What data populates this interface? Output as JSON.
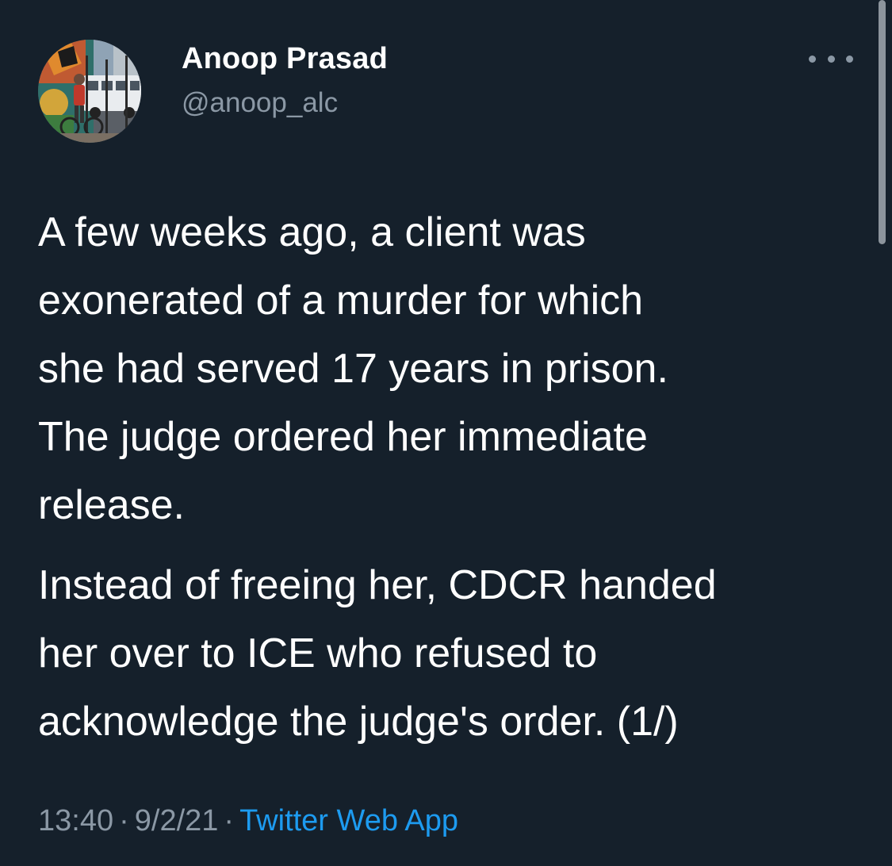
{
  "author": {
    "display_name": "Anoop Prasad",
    "handle": "@anoop_alc",
    "avatar_icon": "profile-photo-mural"
  },
  "menu": {
    "icon": "more-horizontal-icon"
  },
  "tweet": {
    "paragraph_1_lines": [
      "A few weeks ago, a client was",
      "exonerated of a murder for which",
      "she had served 17 years in prison.",
      "The judge ordered her immediate",
      "release."
    ],
    "paragraph_2_lines": [
      "Instead of freeing her, CDCR handed",
      "her over to ICE who refused to",
      "acknowledge the judge's order. (1/)"
    ]
  },
  "meta": {
    "time": "13:40",
    "separator": "·",
    "date": "9/2/21",
    "source": "Twitter Web App"
  },
  "colors": {
    "background": "#15202b",
    "text": "#ffffff",
    "secondary_text": "#8b98a5",
    "link": "#1d9bf0"
  }
}
